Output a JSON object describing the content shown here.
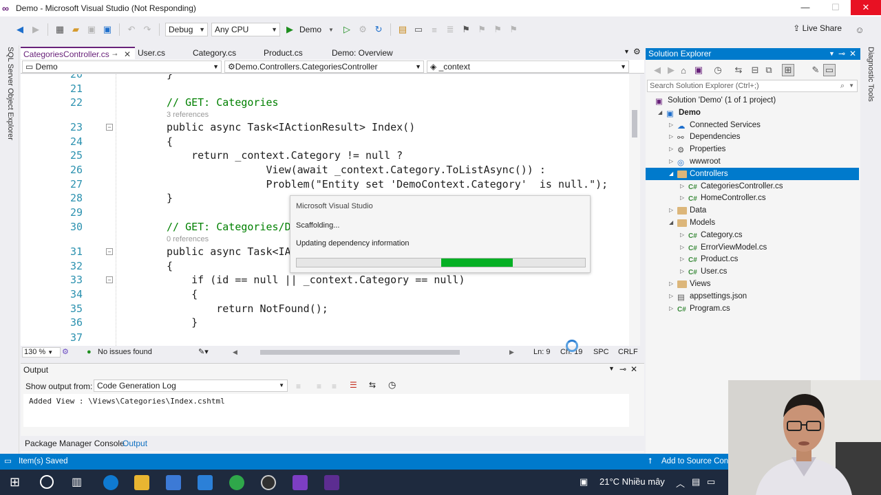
{
  "window": {
    "title": "Demo - Microsoft Visual Studio (Not Responding)",
    "min": "—",
    "max": "☐",
    "close": "✕"
  },
  "toolbar": {
    "config": "Debug",
    "platform": "Any CPU",
    "run_label": "Demo",
    "live_share": "Live Share"
  },
  "left_strip": {
    "label": "SQL Server Object Explorer"
  },
  "right_strip": {
    "label": "Diagnostic Tools"
  },
  "tabs": [
    {
      "label": "CategoriesController.cs",
      "active": true
    },
    {
      "label": "User.cs"
    },
    {
      "label": "Category.cs"
    },
    {
      "label": "Product.cs"
    },
    {
      "label": "Demo: Overview"
    }
  ],
  "nav": {
    "project": "Demo",
    "type": "Demo.Controllers.CategoriesController",
    "member": "_context"
  },
  "code": {
    "lines": [
      {
        "num": "20",
        "text": "}"
      },
      {
        "num": "21",
        "text": ""
      },
      {
        "num": "22",
        "text": "// GET: Categories"
      },
      {
        "num": "23",
        "text": "public async Task<IActionResult> Index()"
      },
      {
        "num": "24",
        "text": "{"
      },
      {
        "num": "25",
        "text": "    return _context.Category != null ?"
      },
      {
        "num": "26",
        "text": "                View(await _context.Category.ToListAsync()) :"
      },
      {
        "num": "27",
        "text": "                Problem(\"Entity set 'DemoContext.Category'  is null.\");"
      },
      {
        "num": "28",
        "text": "}"
      },
      {
        "num": "29",
        "text": ""
      },
      {
        "num": "30",
        "text": "// GET: Categories/D"
      },
      {
        "num": "31",
        "text": "public async Task<IA"
      },
      {
        "num": "32",
        "text": "{"
      },
      {
        "num": "33",
        "text": "    if (id == null || _context.Category == null)"
      },
      {
        "num": "34",
        "text": "    {"
      },
      {
        "num": "35",
        "text": "        return NotFound();"
      },
      {
        "num": "36",
        "text": "    }"
      },
      {
        "num": "37",
        "text": ""
      }
    ],
    "hint1": "3 references",
    "hint2": "0 references"
  },
  "editor_status": {
    "zoom": "130 %",
    "issues": "No issues found",
    "ln": "Ln: 9",
    "ch": "Ch: 19",
    "spc": "SPC",
    "crlf": "CRLF"
  },
  "output": {
    "title": "Output",
    "show_from_label": "Show output from:",
    "source": "Code Generation Log",
    "text": "Added View : \\Views\\Categories\\Index.cshtml",
    "tabs": [
      "Package Manager Console",
      "Output"
    ]
  },
  "solution_explorer": {
    "title": "Solution Explorer",
    "search_placeholder": "Search Solution Explorer (Ctrl+;)",
    "items": [
      {
        "label": "Solution 'Demo' (1 of 1 project)",
        "level": 0,
        "arrow": "",
        "icon": "solution"
      },
      {
        "label": "Demo",
        "level": 1,
        "arrow": "◢",
        "icon": "project",
        "bold": true
      },
      {
        "label": "Connected Services",
        "level": 2,
        "arrow": "▷",
        "icon": "service"
      },
      {
        "label": "Dependencies",
        "level": 2,
        "arrow": "▷",
        "icon": "deps"
      },
      {
        "label": "Properties",
        "level": 2,
        "arrow": "▷",
        "icon": "props"
      },
      {
        "label": "wwwroot",
        "level": 2,
        "arrow": "▷",
        "icon": "globe"
      },
      {
        "label": "Controllers",
        "level": 2,
        "arrow": "◢",
        "icon": "folder",
        "selected": true
      },
      {
        "label": "CategoriesController.cs",
        "level": 3,
        "arrow": "▷",
        "icon": "cs"
      },
      {
        "label": "HomeController.cs",
        "level": 3,
        "arrow": "▷",
        "icon": "cs"
      },
      {
        "label": "Data",
        "level": 2,
        "arrow": "▷",
        "icon": "folder"
      },
      {
        "label": "Models",
        "level": 2,
        "arrow": "◢",
        "icon": "folder"
      },
      {
        "label": "Category.cs",
        "level": 3,
        "arrow": "▷",
        "icon": "cs"
      },
      {
        "label": "ErrorViewModel.cs",
        "level": 3,
        "arrow": "▷",
        "icon": "cs"
      },
      {
        "label": "Product.cs",
        "level": 3,
        "arrow": "▷",
        "icon": "cs"
      },
      {
        "label": "User.cs",
        "level": 3,
        "arrow": "▷",
        "icon": "cs"
      },
      {
        "label": "Views",
        "level": 2,
        "arrow": "▷",
        "icon": "folder"
      },
      {
        "label": "appsettings.json",
        "level": 2,
        "arrow": "▷",
        "icon": "json"
      },
      {
        "label": "Program.cs",
        "level": 2,
        "arrow": "▷",
        "icon": "cs"
      }
    ]
  },
  "dialog": {
    "title": "Microsoft Visual Studio",
    "line1": "Scaffolding...",
    "line2": "Updating dependency information",
    "progress_start": 0.5,
    "progress_end": 0.75
  },
  "status": {
    "message": "Item(s) Saved",
    "source_control": "Add to Source Cont"
  },
  "taskbar": {
    "weather": "21°C  Nhiều mây",
    "accent": "#007acc"
  }
}
